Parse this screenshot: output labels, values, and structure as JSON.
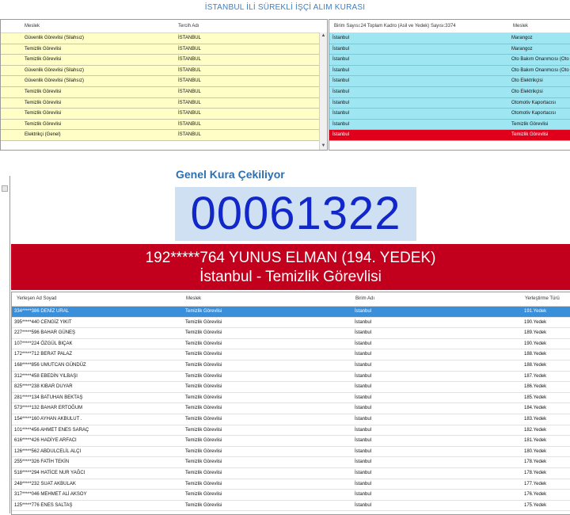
{
  "app": {
    "title": "İSTANBUL İLİ SÜREKLİ İŞÇİ ALIM KURASI"
  },
  "left_table": {
    "headers": [
      "Meslek",
      "Tercih Adı"
    ],
    "rows": [
      [
        "Güvenlik Görevlisi (Silahsız)",
        "İSTANBUL"
      ],
      [
        "Temizlik Görevlisi",
        "İSTANBUL"
      ],
      [
        "Temizlik Görevlisi",
        "İSTANBUL"
      ],
      [
        "Güvenlik Görevlisi (Silahsız)",
        "İSTANBUL"
      ],
      [
        "Güvenlik Görevlisi (Silahsız)",
        "İSTANBUL"
      ],
      [
        "Temizlik Görevlisi",
        "İSTANBUL"
      ],
      [
        "Temizlik Görevlisi",
        "İSTANBUL"
      ],
      [
        "Temizlik Görevlisi",
        "İSTANBUL"
      ],
      [
        "Temizlik Görevlisi",
        "İSTANBUL"
      ],
      [
        "Elektrikçi (Genel)",
        "İSTANBUL"
      ]
    ]
  },
  "right_table": {
    "headers": [
      "Birim Sayısı:24 Toplam Kadro (Asil ve Yedek) Sayısı:3374",
      "Meslek"
    ],
    "rows": [
      [
        "İstanbul",
        "Marangoz"
      ],
      [
        "İstanbul",
        "Marangoz"
      ],
      [
        "İstanbul",
        "Oto Bakım Onarımcısı (Oto"
      ],
      [
        "İstanbul",
        "Oto Bakım Onarımcısı (Oto"
      ],
      [
        "İstanbul",
        "Oto Elektrikçisi"
      ],
      [
        "İstanbul",
        "Oto Elektrikçisi"
      ],
      [
        "İstanbul",
        "Otomotiv Kaportacısı"
      ],
      [
        "İstanbul",
        "Otomotiv Kaportacısı"
      ],
      [
        "İstanbul",
        "Temizlik Görevlisi"
      ],
      [
        "İstanbul",
        "Temizlik Görevlisi"
      ]
    ]
  },
  "draw": {
    "label": "Genel Kura Çekiliyor",
    "number": "00061322",
    "winner_line1": "192*****764 YUNUS ELMAN (194. YEDEK)",
    "winner_line2": "İstanbul - Temizlik Görevlisi"
  },
  "result_table": {
    "headers": [
      "Yerleşen Ad Soyad",
      "Meslek",
      "Birim Adı",
      "Yerleştirme Türü"
    ],
    "rows": [
      [
        "334*****386 DENİZ URAL",
        "Temizlik Görevlisi",
        "İstanbul",
        "191.Yedek"
      ],
      [
        "395*****440 CENGİZ YIKIT",
        "Temizlik Görevlisi",
        "İstanbul",
        "190.Yedek"
      ],
      [
        "227*****596 BAHAR GÜNEŞ",
        "Temizlik Görevlisi",
        "İstanbul",
        "189.Yedek"
      ],
      [
        "107*****224 ÖZGÜL BIÇAK",
        "Temizlik Görevlisi",
        "İstanbul",
        "190.Yedek"
      ],
      [
        "172*****712 BERAT PALAZ",
        "Temizlik Görevlisi",
        "İstanbul",
        "188.Yedek"
      ],
      [
        "168*****856 UMUTCAN GÜNDÜZ",
        "Temizlik Görevlisi",
        "İstanbul",
        "188.Yedek"
      ],
      [
        "312*****458 EBEDİN YILBAŞI",
        "Temizlik Görevlisi",
        "İstanbul",
        "187.Yedek"
      ],
      [
        "825*****238 KIBAR DUYAR",
        "Temizlik Görevlisi",
        "İstanbul",
        "186.Yedek"
      ],
      [
        "281*****134 BATUHAN BEKTAŞ",
        "Temizlik Görevlisi",
        "İstanbul",
        "185.Yedek"
      ],
      [
        "573*****132 BAHAR ERTOĞUM",
        "Temizlik Görevlisi",
        "İstanbul",
        "184.Yedek"
      ],
      [
        "154*****160 AYHAN AKBULUT .",
        "Temizlik Görevlisi",
        "İstanbul",
        "183.Yedek"
      ],
      [
        "101*****456 AHMET ENES SARAÇ",
        "Temizlik Görevlisi",
        "İstanbul",
        "182.Yedek"
      ],
      [
        "616*****426 HADİYE ARFACI",
        "Temizlik Görevlisi",
        "İstanbul",
        "181.Yedek"
      ],
      [
        "126*****562 ABDULCELİL ALÇI",
        "Temizlik Görevlisi",
        "İstanbul",
        "180.Yedek"
      ],
      [
        "255*****326 FATİH TEKİN",
        "Temizlik Görevlisi",
        "İstanbul",
        "178.Yedek"
      ],
      [
        "518*****294 HATİCE NUR YAĞCI",
        "Temizlik Görevlisi",
        "İstanbul",
        "178.Yedek"
      ],
      [
        "248*****232 SUAT AKBULAK",
        "Temizlik Görevlisi",
        "İstanbul",
        "177.Yedek"
      ],
      [
        "317*****046 MEHMET ALİ AKSOY",
        "Temizlik Görevlisi",
        "İstanbul",
        "176.Yedek"
      ],
      [
        "125*****776 ENES SALTAŞ",
        "Temizlik Görevlisi",
        "İstanbul",
        "175.Yedek"
      ]
    ]
  },
  "colors": {
    "accent": "#3a8fdb",
    "winner_bg": "#c2001d",
    "number": "#1127c9"
  }
}
